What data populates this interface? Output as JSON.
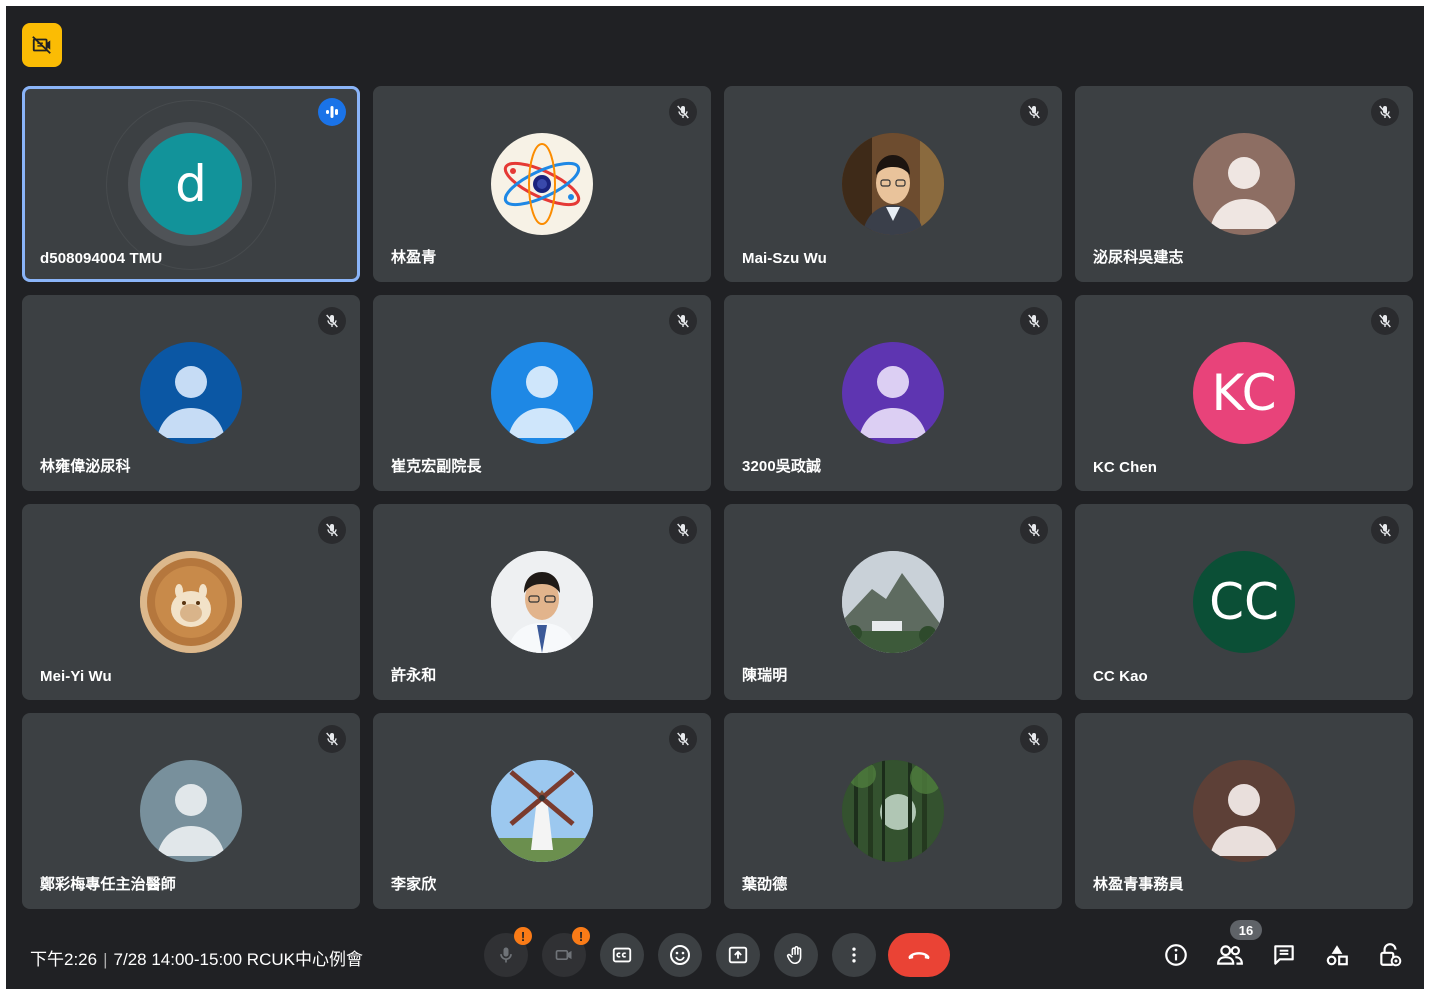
{
  "participants": [
    {
      "name": "d508094004 TMU",
      "initials": "d",
      "avatar_color": "#12939a",
      "speaking": true
    },
    {
      "name": "林盈青",
      "avatar": "atom-photo"
    },
    {
      "name": "Mai-Szu Wu",
      "avatar": "man-portrait-photo"
    },
    {
      "name": "泌尿科吳建志",
      "avatar_color": "#8d6e63"
    },
    {
      "name": "林雍偉泌尿科",
      "avatar_color": "#0b57a4"
    },
    {
      "name": "崔克宏副院長",
      "avatar_color": "#1e88e5"
    },
    {
      "name": "3200吳政誠",
      "avatar_color": "#5e35b1"
    },
    {
      "name": "KC Chen",
      "initials": "KC",
      "avatar_color": "#e8437a"
    },
    {
      "name": "Mei-Yi Wu",
      "avatar": "latte-art-photo"
    },
    {
      "name": "許永和",
      "avatar": "man-portrait-photo"
    },
    {
      "name": "陳瑞明",
      "avatar": "mountain-photo"
    },
    {
      "name": "CC Kao",
      "initials": "CC",
      "avatar_color": "#0b4f36"
    },
    {
      "name": "鄭彩梅專任主治醫師",
      "avatar_color": "#78909c"
    },
    {
      "name": "李家欣",
      "avatar": "windmill-photo"
    },
    {
      "name": "葉劭德",
      "avatar": "bamboo-forest-photo"
    },
    {
      "name": "林盈青事務員",
      "avatar_color": "#5d4037"
    }
  ],
  "footer": {
    "time": "下午2:26",
    "separator": "|",
    "meeting_title": "7/28 14:00-15:00 RCUK中心例會",
    "participant_count": "16"
  },
  "alert_mark": "!",
  "colors": {
    "background": "#202124",
    "tile": "#3c4043",
    "active_border": "#8ab4f8",
    "end_call": "#ea4335",
    "warning": "#fa7b17",
    "badge": "#fbbc04"
  },
  "icons": [
    "hidden-self-view-icon",
    "mic-off-icon",
    "camera-off-icon",
    "captions-icon",
    "emoji-icon",
    "present-icon",
    "raise-hand-icon",
    "more-options-icon",
    "end-call-icon",
    "info-icon",
    "people-icon",
    "chat-icon",
    "activities-icon",
    "host-controls-icon"
  ]
}
